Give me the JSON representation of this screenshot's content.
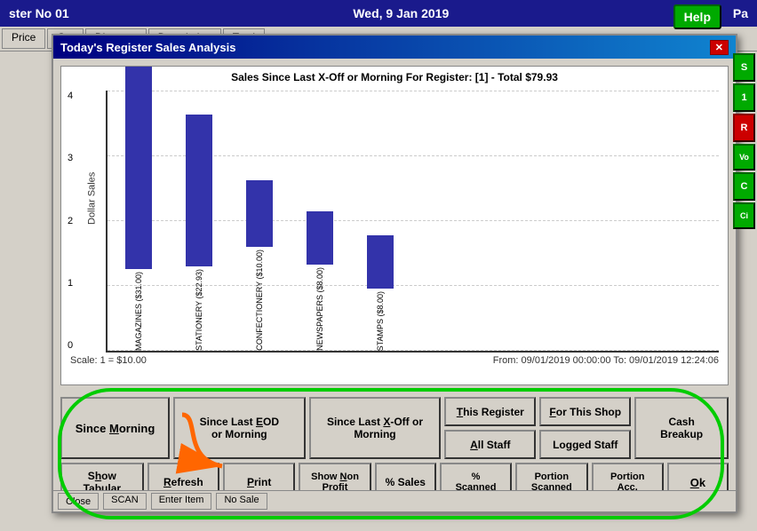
{
  "header": {
    "register_no": "ster No 01",
    "date": "Wed, 9 Jan 2019",
    "help_label": "Help",
    "pay_label": "Pa"
  },
  "dialog": {
    "title": "Today's Register Sales Analysis",
    "close_label": "✕"
  },
  "chart": {
    "title": "Sales Since Last X-Off or Morning For Register: [1] - Total $79.93",
    "y_label": "Dollar Sales",
    "x_scale_label": "Scale: 1 = $10.00",
    "date_range": "From: 09/01/2019 00:00:00   To: 09/01/2019 12:24:06",
    "y_axis": [
      "4",
      "3",
      "2",
      "1",
      "0"
    ],
    "bars": [
      {
        "label": "MAGAZINES ($31.00)",
        "height_pct": 77,
        "color": "#3333aa"
      },
      {
        "label": "STATIONERY ($22.93)",
        "height_pct": 57,
        "color": "#3333aa"
      },
      {
        "label": "CONFECTIONERY ($10.00)",
        "height_pct": 25,
        "color": "#3333aa"
      },
      {
        "label": "NEWSPAPERS ($8.00)",
        "height_pct": 20,
        "color": "#3333aa"
      },
      {
        "label": "STAMPS ($8.00)",
        "height_pct": 20,
        "color": "#3333aa"
      }
    ]
  },
  "buttons": {
    "row1": [
      {
        "id": "since-morning",
        "label": "Since Morning",
        "underline": "M"
      },
      {
        "id": "since-last-eod",
        "label": "Since Last EOD or Morning",
        "underline": "E"
      },
      {
        "id": "since-last-xoff",
        "label": "Since Last X-Off or Morning",
        "underline": "X"
      },
      {
        "id": "this-register",
        "label": "This Register",
        "underline": "T"
      },
      {
        "id": "for-this-shop",
        "label": "For This Shop",
        "underline": "F"
      },
      {
        "id": "cash-breakup",
        "label": "Cash Breakup",
        "underline": "C"
      }
    ],
    "row2": [
      {
        "id": "all-staff",
        "label": "All Staff",
        "underline": "A"
      },
      {
        "id": "logged-staff",
        "label": "Logged Staff",
        "underline": "L"
      }
    ],
    "row3": [
      {
        "id": "show-tabular",
        "label": "Show Tabular",
        "underline": "T"
      },
      {
        "id": "refresh",
        "label": "Refresh",
        "underline": "R"
      },
      {
        "id": "print",
        "label": "Print",
        "underline": "P"
      },
      {
        "id": "show-non-profit",
        "label": "Show Non Profit",
        "underline": "N"
      },
      {
        "id": "pct-sales",
        "label": "% Sales",
        "underline": "%"
      },
      {
        "id": "pct-scanned",
        "label": "% Scanned",
        "underline": "S"
      },
      {
        "id": "portion-scanned",
        "label": "Portion Scanned",
        "underline": "P"
      },
      {
        "id": "portion-acc",
        "label": "Portion Acc.",
        "underline": "A"
      },
      {
        "id": "ok",
        "label": "Ok",
        "underline": "O"
      }
    ]
  },
  "status_bar": {
    "close_label": "Close",
    "scan_label": "SCAN",
    "enter_label": "Enter Item",
    "no_sale_label": "No Sale"
  },
  "side_buttons": [
    "S",
    "1",
    "Vo",
    "C",
    "Ci"
  ]
}
